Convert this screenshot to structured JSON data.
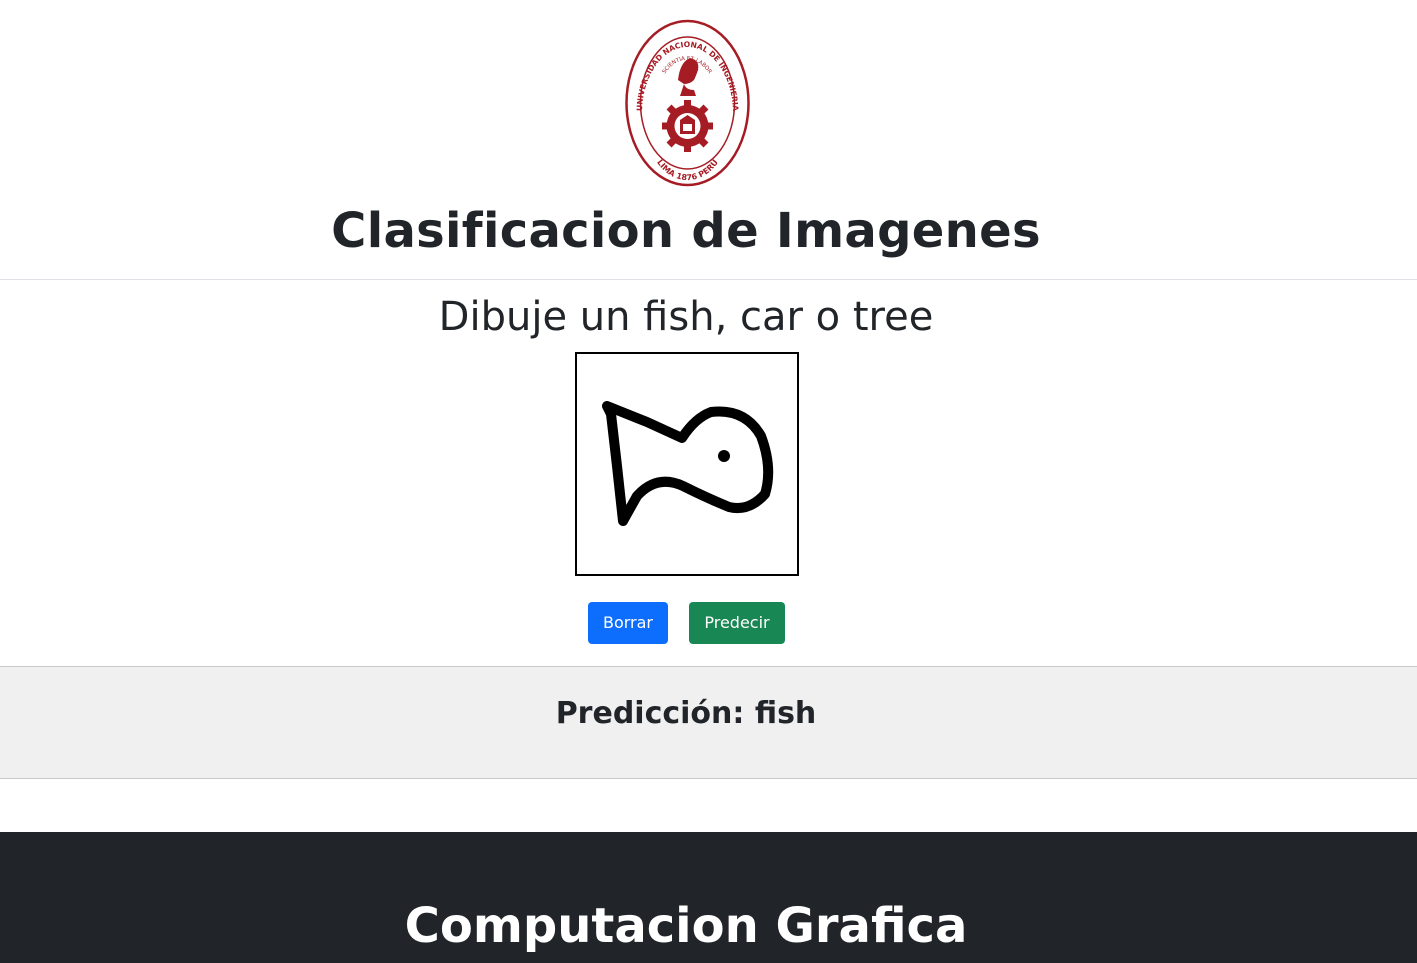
{
  "header": {
    "logo": {
      "ring_text": "UNIVERSIDAD NACIONAL DE INGENIERIA",
      "motto": "SCIENTIA ET LABOR",
      "bottom_text": "LIMA 1876 PERU",
      "color": "#a51c24"
    },
    "title": "Clasificacion de Imagenes"
  },
  "main": {
    "subtitle": "Dibuje un fish, car o tree",
    "canvas": {
      "drawing": "fish sketch",
      "stroke_color": "#000000"
    },
    "buttons": {
      "clear_label": "Borrar",
      "predict_label": "Predecir"
    },
    "button_colors": {
      "clear": "#0d6efd",
      "predict": "#198754"
    }
  },
  "prediction": {
    "text": "Predicción: fish"
  },
  "footer": {
    "title": "Computacion Grafica",
    "background": "#212529"
  }
}
